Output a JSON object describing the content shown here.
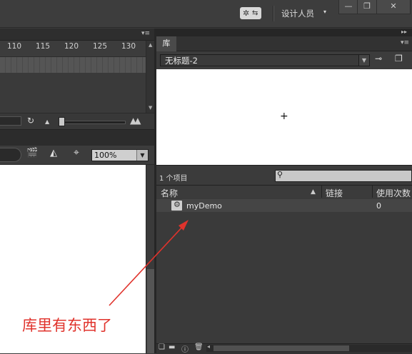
{
  "topbar": {
    "workspace_label": "设计人员",
    "workspace_caret": "▾",
    "minimize": "—",
    "maximize": "❐",
    "close": "✕"
  },
  "timeline": {
    "panel_menu": "▾≡",
    "ruler_ticks": [
      "110",
      "115",
      "120",
      "125",
      "130"
    ],
    "zoom_value": "100%"
  },
  "library": {
    "tab_label": "库",
    "panel_menu": "▾≡",
    "collapse": "▸▸",
    "document": "无标题-2",
    "preview_marker": "+",
    "item_count": "1 个项目",
    "search_placeholder": "",
    "columns": {
      "name": "名称",
      "linkage": "链接",
      "use_count": "使用次数"
    },
    "items": [
      {
        "name": "myDemo",
        "use_count": "0"
      }
    ]
  },
  "annotation": {
    "text": "库里有东西了",
    "color": "#e0332c"
  },
  "icons": {
    "sync": "sync-settings-icon",
    "pin": "pin-icon",
    "new_library": "new-library-icon",
    "item_type": "movieclip-symbol-icon"
  }
}
